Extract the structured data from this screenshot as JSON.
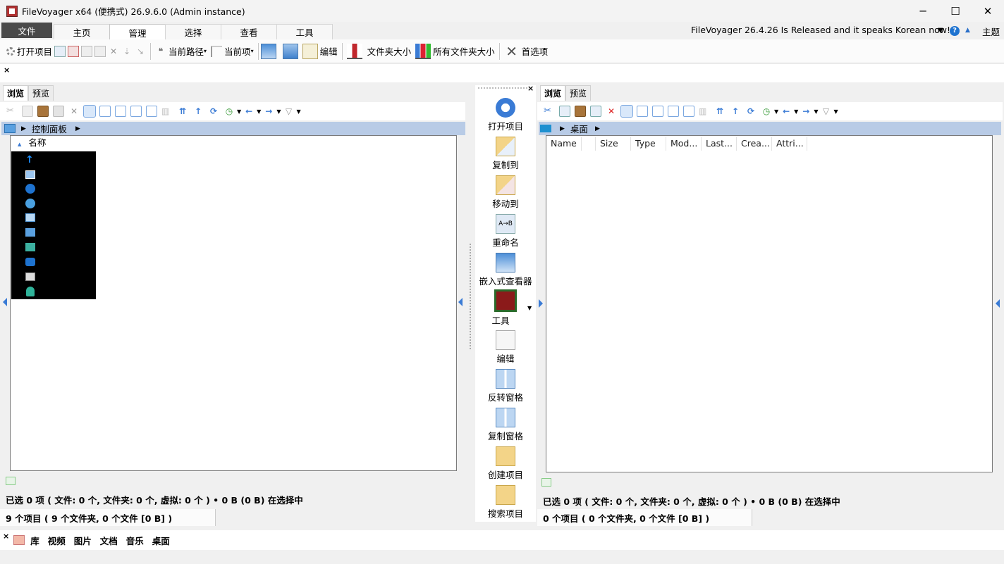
{
  "window": {
    "title": "FileVoyager x64 (便携式) 26.9.6.0 (Admin instance)",
    "minimize": "─",
    "maximize": "☐",
    "close": "✕"
  },
  "ribbon_tabs": {
    "file": "文件",
    "tabs": [
      "主页",
      "管理",
      "选择",
      "查看",
      "工具"
    ],
    "active": "管理",
    "announcement": "FileVoyager 26.4.26 Is Released and it speaks Korean now!",
    "theme": "主题"
  },
  "ribbon": {
    "open_item": "打开项目",
    "current_path": "当前路径",
    "current_item": "当前项",
    "edit": "编辑",
    "folder_size": "文件夹大小",
    "all_folder_size": "所有文件夹大小",
    "preferences": "首选项"
  },
  "left_pane": {
    "tabs": [
      "浏览",
      "预览"
    ],
    "breadcrumb": "控制面板",
    "column_name": "名称",
    "status_selected": "已选 0 项 ( 文件: 0 个, 文件夹: 0 个, 虚拟: 0 个 ) • 0 B (0 B) 在选择中",
    "status_total": "9 个项目 ( 9 个文件夹, 0 个文件 [0 B] )",
    "item_icons": [
      "up-arrow-icon",
      "window-icon",
      "accessibility-icon",
      "globe-lock-icon",
      "monitor-icon",
      "display-icon",
      "network-icon",
      "programs-icon",
      "printer-icon",
      "user-icon"
    ]
  },
  "right_pane": {
    "tabs": [
      "浏览",
      "预览"
    ],
    "breadcrumb": "桌面",
    "columns": [
      "Name",
      "",
      "Size",
      "Type",
      "Mod...",
      "Last...",
      "Crea...",
      "Attri..."
    ],
    "status_selected": "已选 0 项 ( 文件: 0 个, 文件夹: 0 个, 虚拟: 0 个 ) • 0 B (0 B) 在选择中",
    "status_total": "0 个项目 ( 0 个文件夹, 0 个文件 [0 B] )"
  },
  "center_commands": [
    "打开项目",
    "复制到",
    "移动到",
    "重命名",
    "嵌入式查看器",
    "工具",
    "编辑",
    "反转窗格",
    "复制窗格",
    "创建项目",
    "搜索项目"
  ],
  "bottom_bar": [
    "库",
    "视频",
    "图片",
    "文档",
    "音乐",
    "桌面"
  ],
  "colors": {
    "accent": "#1e73d0",
    "address_bar": "#b8cbe6",
    "file_tab": "#4a4a4a"
  }
}
